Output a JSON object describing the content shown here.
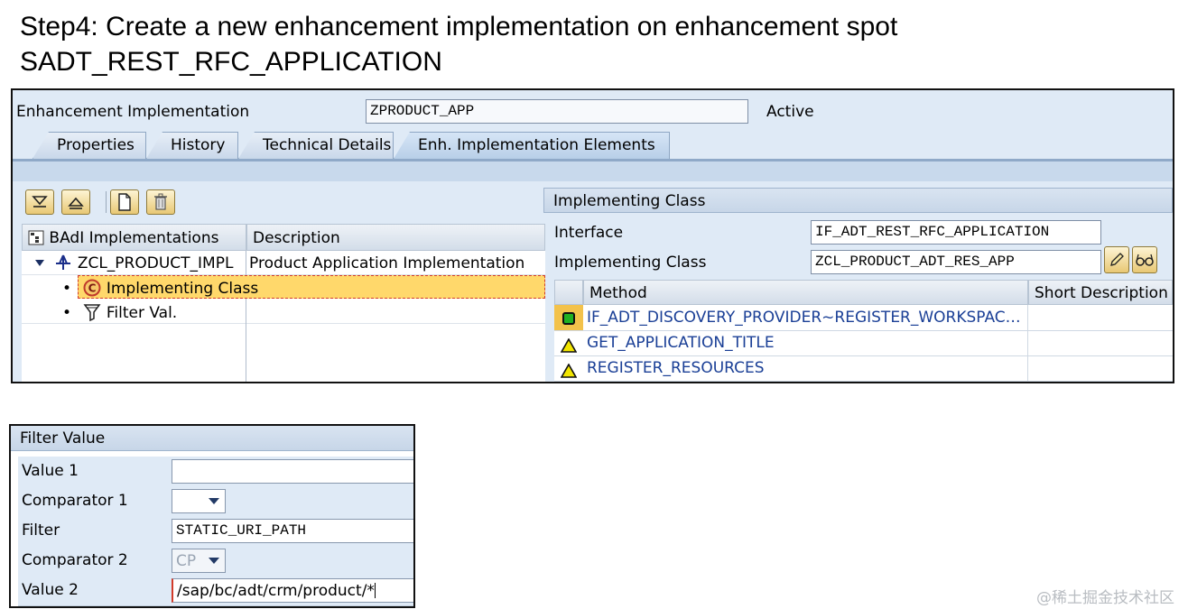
{
  "heading": {
    "line1": "Step4: Create a new enhancement implementation on enhancement spot",
    "line2": "SADT_REST_RFC_APPLICATION"
  },
  "header": {
    "label": "Enhancement Implementation",
    "value": "ZPRODUCT_APP",
    "status": "Active"
  },
  "tabs": [
    {
      "label": "Properties",
      "active": false
    },
    {
      "label": "History",
      "active": false
    },
    {
      "label": "Technical Details",
      "active": false
    },
    {
      "label": "Enh. Implementation Elements",
      "active": true
    }
  ],
  "toolbar": {
    "icons": [
      "expand-all-icon",
      "collapse-all-icon",
      "create-icon",
      "delete-icon"
    ]
  },
  "tree": {
    "columns": [
      "BAdI Implementations",
      "Description"
    ],
    "rows": [
      {
        "name": "ZCL_PRODUCT_IMPL",
        "description": "Product Application Implementation",
        "level": 0,
        "icon": "badi-icon"
      },
      {
        "name": "Implementing Class",
        "description": "",
        "level": 1,
        "icon": "class-icon",
        "selected": true
      },
      {
        "name": "Filter Val.",
        "description": "",
        "level": 1,
        "icon": "filter-icon"
      }
    ]
  },
  "implementing_class_panel": {
    "title": "Implementing Class",
    "interface_label": "Interface",
    "interface_value": "IF_ADT_REST_RFC_APPLICATION",
    "class_label": "Implementing Class",
    "class_value": "ZCL_PRODUCT_ADT_RES_APP",
    "buttons": [
      "edit-pencil-icon",
      "display-glasses-icon"
    ],
    "columns": [
      "Method",
      "Short Description"
    ],
    "methods": [
      {
        "name": "IF_ADT_DISCOVERY_PROVIDER~REGISTER_WORKSPAC…",
        "status": "implemented",
        "status_color": "#22b022"
      },
      {
        "name": "GET_APPLICATION_TITLE",
        "status": "not-implemented",
        "status_color": "#f2e500"
      },
      {
        "name": "REGISTER_RESOURCES",
        "status": "not-implemented",
        "status_color": "#f2e500"
      }
    ]
  },
  "filter_panel": {
    "title": "Filter Value",
    "rows": [
      {
        "label": "Value 1",
        "value": "",
        "type": "text"
      },
      {
        "label": "Comparator 1",
        "value": "",
        "type": "dropdown"
      },
      {
        "label": "Filter",
        "value": "STATIC_URI_PATH",
        "type": "text"
      },
      {
        "label": "Comparator 2",
        "value": "CP",
        "type": "dropdown",
        "disabled": true
      },
      {
        "label": "Value 2",
        "value": "/sap/bc/adt/crm/product/*",
        "type": "text"
      }
    ]
  },
  "watermark": "@稀土掘金技术社区",
  "colors": {
    "sap_background": "#dfeaf6",
    "selection": "#ffd86b",
    "link": "#1a3f96"
  }
}
